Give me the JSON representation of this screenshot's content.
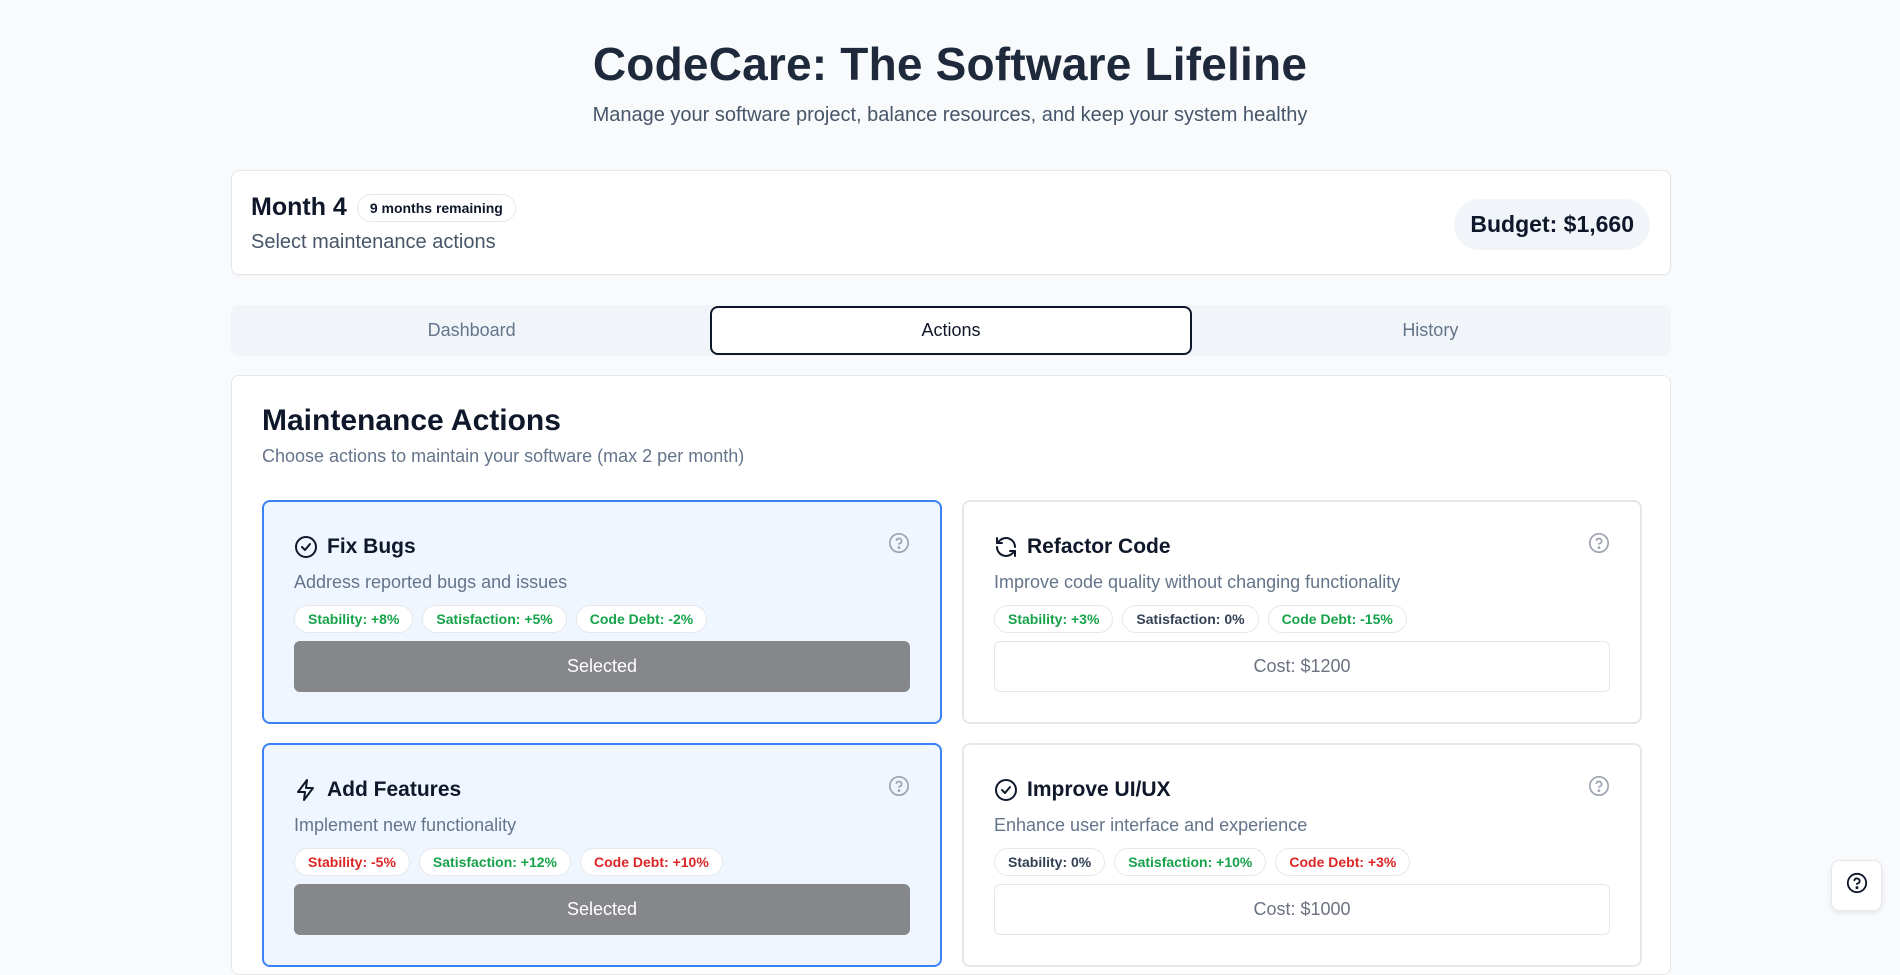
{
  "header": {
    "title": "CodeCare: The Software Lifeline",
    "subtitle": "Manage your software project, balance resources, and keep your system healthy"
  },
  "status": {
    "month": "Month 4",
    "months_remaining": "9 months remaining",
    "instruction": "Select maintenance actions",
    "budget": "Budget: $1,660"
  },
  "tabs": [
    {
      "label": "Dashboard",
      "active": false
    },
    {
      "label": "Actions",
      "active": true
    },
    {
      "label": "History",
      "active": false
    }
  ],
  "panel": {
    "title": "Maintenance Actions",
    "subtitle": "Choose actions to maintain your software (max 2 per month)"
  },
  "actions": [
    {
      "title": "Fix Bugs",
      "icon": "check-circle-icon",
      "description": "Address reported bugs and issues",
      "selected": true,
      "effects": [
        {
          "text": "Stability: +8%",
          "tone": "positive"
        },
        {
          "text": "Satisfaction: +5%",
          "tone": "positive"
        },
        {
          "text": "Code Debt: -2%",
          "tone": "positive"
        }
      ],
      "button": "Selected"
    },
    {
      "title": "Refactor Code",
      "icon": "refresh-icon",
      "description": "Improve code quality without changing functionality",
      "selected": false,
      "effects": [
        {
          "text": "Stability: +3%",
          "tone": "positive"
        },
        {
          "text": "Satisfaction: 0%",
          "tone": "neutral"
        },
        {
          "text": "Code Debt: -15%",
          "tone": "positive"
        }
      ],
      "button": "Cost: $1200"
    },
    {
      "title": "Add Features",
      "icon": "lightning-icon",
      "description": "Implement new functionality",
      "selected": true,
      "effects": [
        {
          "text": "Stability: -5%",
          "tone": "negative"
        },
        {
          "text": "Satisfaction: +12%",
          "tone": "positive"
        },
        {
          "text": "Code Debt: +10%",
          "tone": "negative"
        }
      ],
      "button": "Selected"
    },
    {
      "title": "Improve UI/UX",
      "icon": "check-circle-icon",
      "description": "Enhance user interface and experience",
      "selected": false,
      "effects": [
        {
          "text": "Stability: 0%",
          "tone": "neutral"
        },
        {
          "text": "Satisfaction: +10%",
          "tone": "positive"
        },
        {
          "text": "Code Debt: +3%",
          "tone": "negative"
        }
      ],
      "button": "Cost: $1000"
    }
  ],
  "colors": {
    "selected_border": "#3b82f6",
    "selected_bg": "#eff6ff",
    "positive": "#16a34a",
    "negative": "#dc2626",
    "neutral": "#334155",
    "selected_button": "#85878a"
  }
}
